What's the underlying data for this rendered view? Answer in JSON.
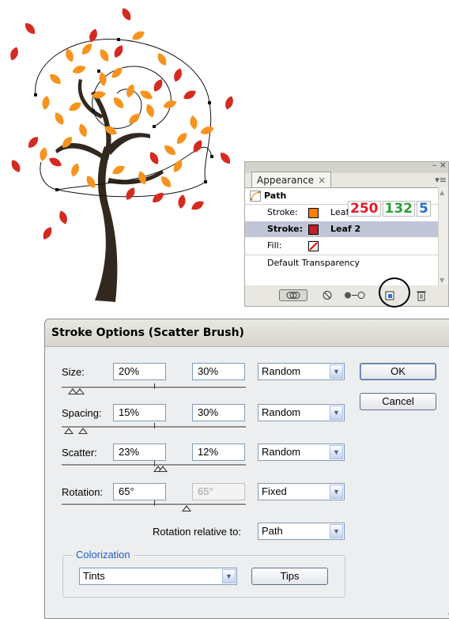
{
  "appearance_panel": {
    "tab_label": "Appearance",
    "tab_close": "×",
    "window_controls": "– ×",
    "menu_glyph": "▾≡",
    "rows": [
      {
        "label": "Path"
      },
      {
        "label": "Stroke:",
        "swatch": "#ff7f00",
        "brush": "Leaf 2"
      },
      {
        "label": "Stroke:",
        "swatch": "#c0202a",
        "brush": "Leaf 2"
      },
      {
        "label": "Fill:",
        "swatch": "none"
      },
      {
        "label": "Default Transparency"
      }
    ],
    "rgb_values": [
      "250",
      "132",
      "5"
    ],
    "rgb_colors": [
      "#e01b24",
      "#2e9e3b",
      "#1f6fd1"
    ],
    "footer_icons": [
      "new-art-icon",
      "clear-icon",
      "reduce-basic-icon",
      "duplicate-item-icon",
      "delete-item-icon"
    ]
  },
  "dialog": {
    "title": "Stroke Options (Scatter Brush)",
    "params": [
      {
        "label": "Size:",
        "value1": "20%",
        "value2": "30%",
        "mode": "Random"
      },
      {
        "label": "Spacing:",
        "value1": "15%",
        "value2": "30%",
        "mode": "Random"
      },
      {
        "label": "Scatter:",
        "value1": "23%",
        "value2": "12%",
        "mode": "Random"
      },
      {
        "label": "Rotation:",
        "value1": "65°",
        "value2": "65°",
        "mode": "Fixed"
      }
    ],
    "rotation_relative_label": "Rotation relative to:",
    "rotation_relative_value": "Path",
    "colorization_legend": "Colorization",
    "colorization_method": "Tints",
    "tips_button": "Tips",
    "ok_button": "OK",
    "cancel_button": "Cancel"
  },
  "colors": {
    "leaf_orange": "#f7931e",
    "leaf_red": "#d42a20",
    "trunk": "#33281d"
  }
}
